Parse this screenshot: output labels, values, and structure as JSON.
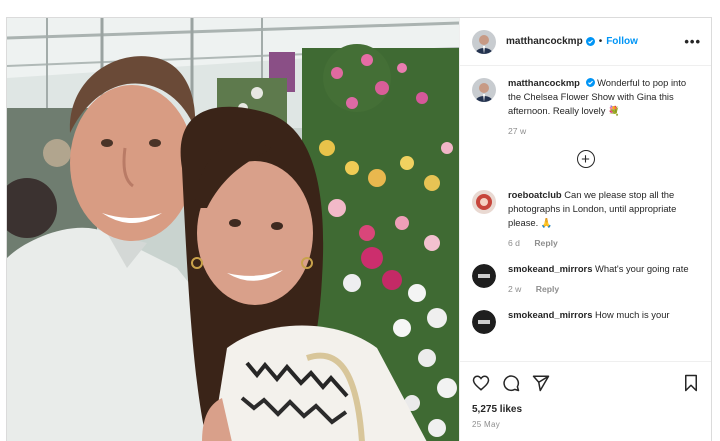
{
  "post": {
    "username": "matthancockmp",
    "follow_label": "Follow",
    "more_label": "•••",
    "likes": "5,275 likes",
    "date": "25 May"
  },
  "caption": {
    "username": "matthancockmp",
    "text": "Wonderful to pop into the Chelsea Flower Show with Gina this afternoon. Really lovely 💐",
    "age": "27 w"
  },
  "load_more_label": "+",
  "comments": [
    {
      "username": "roeboatclub",
      "text": "Can we please stop all the photographs in London, until appropriate please. 🙏",
      "age": "6 d",
      "reply": "Reply"
    },
    {
      "username": "smokeand_mirrors",
      "text": "What's your going rate",
      "age": "2 w",
      "reply": "Reply"
    },
    {
      "username": "smokeand_mirrors",
      "text": "How much is your"
    }
  ],
  "colors": {
    "accent": "#0095f6",
    "verified": "#0095f6",
    "muted": "#8e8e8e"
  },
  "icons": [
    "heart-icon",
    "comment-icon",
    "share-icon",
    "bookmark-icon"
  ]
}
